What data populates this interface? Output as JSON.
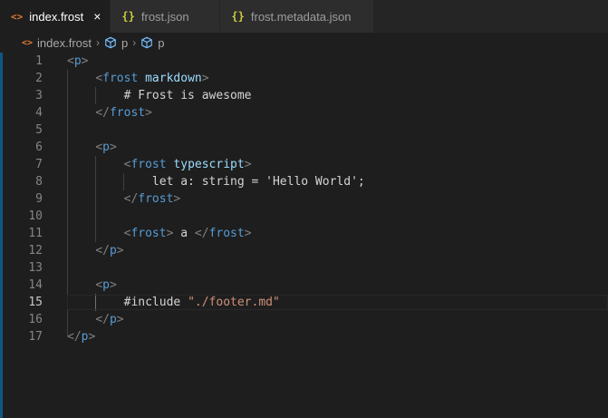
{
  "tabs": [
    {
      "label": "index.frost",
      "icon": "code-file-icon",
      "active": true
    },
    {
      "label": "frost.json",
      "icon": "json-braces-icon",
      "active": false
    },
    {
      "label": "frost.metadata.json",
      "icon": "json-braces-icon",
      "active": false
    }
  ],
  "tab_icon_code": "<>",
  "tab_icon_json": "{}",
  "tab_close": "×",
  "breadcrumb": {
    "file": "index.frost",
    "sep": "›",
    "items": [
      "p",
      "p"
    ]
  },
  "editor": {
    "active_line": 15,
    "lines": [
      {
        "n": "1",
        "tokens": [
          [
            "tag-br",
            "<"
          ],
          [
            "tag",
            "p"
          ],
          [
            "tag-br",
            ">"
          ]
        ]
      },
      {
        "n": "2",
        "tokens": [
          [
            "txt",
            "    "
          ],
          [
            "tag-br",
            "<"
          ],
          [
            "tag",
            "frost"
          ],
          [
            "txt",
            " "
          ],
          [
            "attr",
            "markdown"
          ],
          [
            "tag-br",
            ">"
          ]
        ]
      },
      {
        "n": "3",
        "tokens": [
          [
            "txt",
            "        # Frost is awesome"
          ]
        ]
      },
      {
        "n": "4",
        "tokens": [
          [
            "txt",
            "    "
          ],
          [
            "tag-br",
            "</"
          ],
          [
            "tag",
            "frost"
          ],
          [
            "tag-br",
            ">"
          ]
        ]
      },
      {
        "n": "5",
        "tokens": []
      },
      {
        "n": "6",
        "tokens": [
          [
            "txt",
            "    "
          ],
          [
            "tag-br",
            "<"
          ],
          [
            "tag",
            "p"
          ],
          [
            "tag-br",
            ">"
          ]
        ]
      },
      {
        "n": "7",
        "tokens": [
          [
            "txt",
            "        "
          ],
          [
            "tag-br",
            "<"
          ],
          [
            "tag",
            "frost"
          ],
          [
            "txt",
            " "
          ],
          [
            "attr",
            "typescript"
          ],
          [
            "tag-br",
            ">"
          ]
        ]
      },
      {
        "n": "8",
        "tokens": [
          [
            "txt",
            "            let a: string = 'Hello World';"
          ]
        ]
      },
      {
        "n": "9",
        "tokens": [
          [
            "txt",
            "        "
          ],
          [
            "tag-br",
            "</"
          ],
          [
            "tag",
            "frost"
          ],
          [
            "tag-br",
            ">"
          ]
        ]
      },
      {
        "n": "10",
        "tokens": []
      },
      {
        "n": "11",
        "tokens": [
          [
            "txt",
            "        "
          ],
          [
            "tag-br",
            "<"
          ],
          [
            "tag",
            "frost"
          ],
          [
            "tag-br",
            ">"
          ],
          [
            "txt",
            " a "
          ],
          [
            "tag-br",
            "</"
          ],
          [
            "tag",
            "frost"
          ],
          [
            "tag-br",
            ">"
          ]
        ]
      },
      {
        "n": "12",
        "tokens": [
          [
            "txt",
            "    "
          ],
          [
            "tag-br",
            "</"
          ],
          [
            "tag",
            "p"
          ],
          [
            "tag-br",
            ">"
          ]
        ]
      },
      {
        "n": "13",
        "tokens": []
      },
      {
        "n": "14",
        "tokens": [
          [
            "txt",
            "    "
          ],
          [
            "tag-br",
            "<"
          ],
          [
            "tag",
            "p"
          ],
          [
            "tag-br",
            ">"
          ]
        ]
      },
      {
        "n": "15",
        "tokens": [
          [
            "txt",
            "        #include "
          ],
          [
            "str",
            "\"./footer.md\""
          ]
        ]
      },
      {
        "n": "16",
        "tokens": [
          [
            "txt",
            "    "
          ],
          [
            "tag-br",
            "</"
          ],
          [
            "tag",
            "p"
          ],
          [
            "tag-br",
            ">"
          ]
        ]
      },
      {
        "n": "17",
        "tokens": [
          [
            "tag-br",
            "</"
          ],
          [
            "tag",
            "p"
          ],
          [
            "tag-br",
            ">"
          ]
        ]
      }
    ]
  },
  "colors": {
    "accent": "#0e639c",
    "tag": "#569cd6",
    "attr": "#9cdcfe",
    "string": "#ce9178",
    "bracket": "#808080"
  }
}
